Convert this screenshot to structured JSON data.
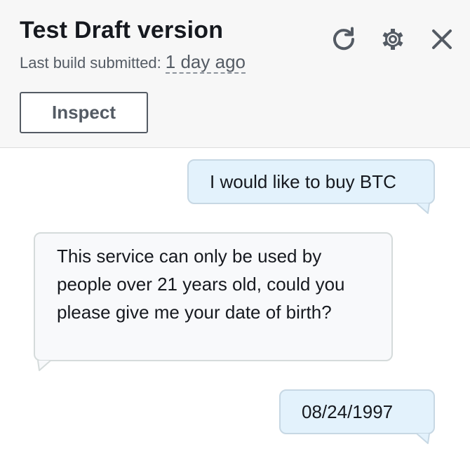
{
  "header": {
    "title": "Test Draft version",
    "subtitle_label": "Last build submitted:",
    "subtitle_time": "1 day ago",
    "inspect_label": "Inspect",
    "icons": {
      "refresh": "refresh-icon",
      "settings": "gear-icon",
      "close": "close-icon"
    }
  },
  "messages": [
    {
      "sender": "user",
      "text": "I would like to buy BTC"
    },
    {
      "sender": "bot",
      "text": "This service can only be used by people over 21 years old, could you please give me your date of birth?"
    },
    {
      "sender": "user",
      "text": "08/24/1997"
    }
  ],
  "colors": {
    "header_background": "#f7f7f7",
    "user_bubble": "#e3f2fc",
    "bot_bubble": "#f8f9fb",
    "text": "#16191f",
    "muted_text": "#545b64"
  }
}
